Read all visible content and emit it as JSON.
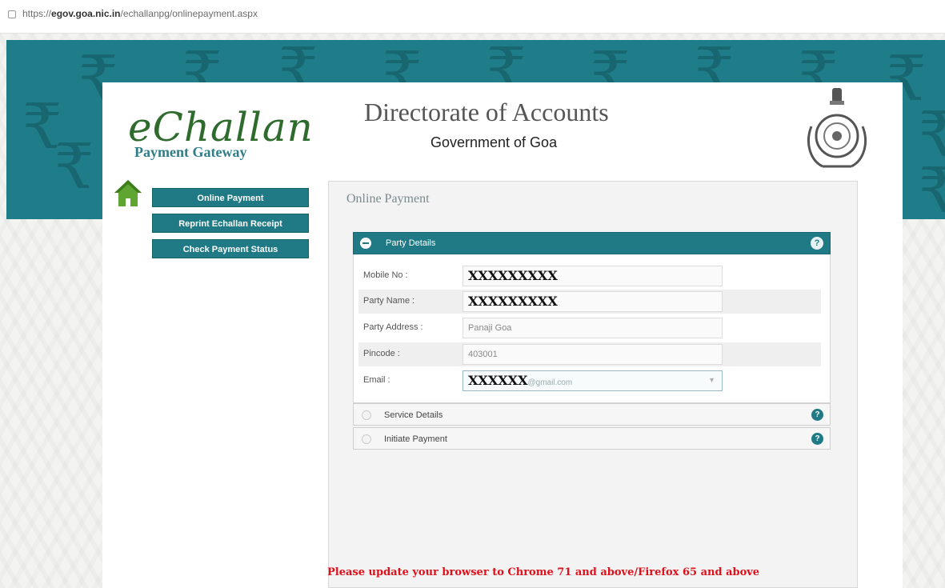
{
  "browser": {
    "url_prefix": "https://",
    "url_host": "egov.goa.nic.in",
    "url_path": "/echallanpg/onlinepayment.aspx"
  },
  "header": {
    "logo_text": "eChallan",
    "logo_subtitle": "Payment Gateway",
    "title": "Directorate of Accounts",
    "subtitle": "Government of Goa"
  },
  "nav": {
    "items": [
      {
        "label": "Online Payment"
      },
      {
        "label": "Reprint Echallan Receipt"
      },
      {
        "label": "Check Payment Status"
      }
    ]
  },
  "panel": {
    "title": "Online Payment",
    "sections": [
      {
        "label": "Party Details",
        "expanded": true
      },
      {
        "label": "Service Details",
        "expanded": false
      },
      {
        "label": "Initiate Payment",
        "expanded": false
      }
    ]
  },
  "form": {
    "mobile_label": "Mobile No :",
    "mobile_value": "XXXXXXXXX",
    "name_label": "Party Name :",
    "name_value": "XXXXXXXXX",
    "address_label": "Party Address :",
    "address_value": "Panaji Goa",
    "pincode_label": "Pincode :",
    "pincode_value": "403001",
    "email_label": "Email :",
    "email_mask": "XXXXXX",
    "email_suffix": "@gmail.com"
  },
  "notice": {
    "text": "Please update your browser to Chrome 71 and above/Firefox 65 and above"
  },
  "icons": {
    "home": "home-icon",
    "emblem": "goa-emblem-icon",
    "help": "help-icon"
  },
  "colors": {
    "teal": "#1f7a86",
    "logo_green": "#2e6b2d",
    "warning_red": "#e0101a"
  }
}
